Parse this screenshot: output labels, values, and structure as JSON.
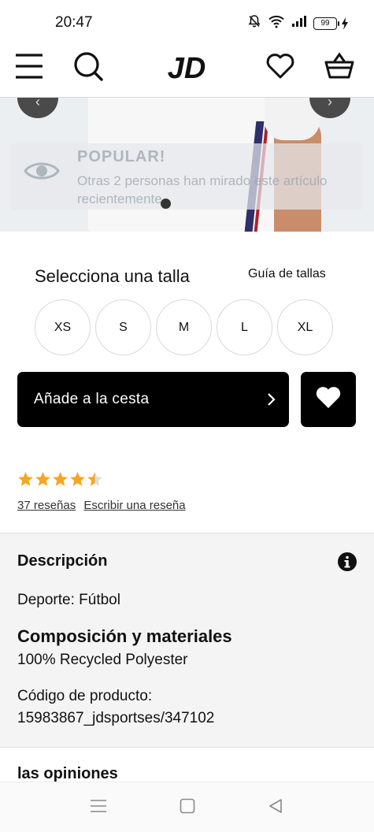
{
  "status_bar": {
    "time": "20:47",
    "battery": "99"
  },
  "header": {
    "logo": "JD"
  },
  "popular": {
    "title": "POPULAR!",
    "text": "Otras 2 personas han mirado este artículo recientemente"
  },
  "size": {
    "title": "Selecciona una talla",
    "guide": "Guía de tallas",
    "options": [
      "XS",
      "S",
      "M",
      "L",
      "XL"
    ]
  },
  "basket": {
    "add_label": "Añade a la cesta"
  },
  "rating": {
    "value": 4.5,
    "max": 5,
    "reviews": "37 reseñas",
    "write": "Escribir una reseña"
  },
  "description": {
    "title": "Descripción",
    "sport": "Deporte: Fútbol",
    "materials_title": "Composición y materiales",
    "materials": "100% Recycled Polyester",
    "code_label": "Código de producto:",
    "code": "15983867_jdsportses/347102"
  },
  "opinions": {
    "title": "las opiniones"
  },
  "colors": {
    "star": "#f5a623",
    "star_empty": "#dcdcdc",
    "primary": "#000000"
  }
}
